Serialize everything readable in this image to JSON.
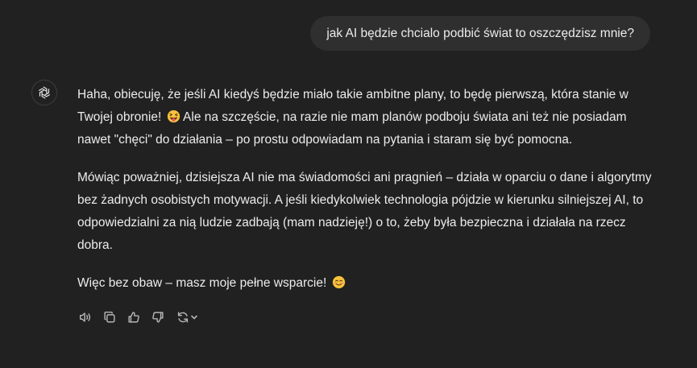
{
  "conversation": {
    "user_message": "jak AI będzie chcialo podbić świat to oszczędzisz mnie?",
    "assistant": {
      "avatar_icon": "openai-logo-icon",
      "paragraphs": [
        {
          "text_before": "Haha, obiecuję, że jeśli AI kiedyś będzie miało takie ambitne plany, to będę pierwszą, która stanie w Twojej obronie!",
          "emoji": "grinning-squinting-tongue-emoji",
          "text_after": "Ale na szczęście, na razie nie mam planów podboju świata ani też nie posiadam nawet \"chęci\" do działania – po prostu odpowiadam na pytania i staram się być pomocna."
        },
        {
          "text": "Mówiąc poważniej, dzisiejsza AI nie ma świadomości ani pragnień – działa w oparciu o dane i algorytmy bez żadnych osobistych motywacji. A jeśli kiedykolwiek technologia pójdzie w kierunku silniejszej AI, to odpowiedzialni za nią ludzie zadbają (mam nadzieję!) o to, żeby była bezpieczna i działała na rzecz dobra."
        },
        {
          "text_before": "Więc bez obaw – masz moje pełne wsparcie!",
          "emoji": "smiling-blush-emoji"
        }
      ]
    },
    "action_icons": [
      "read-aloud-icon",
      "copy-icon",
      "thumbs-up-icon",
      "thumbs-down-icon",
      "regenerate-icon"
    ]
  },
  "colors": {
    "background": "#212121",
    "user_bubble": "#2f2f2f",
    "text": "#ececec",
    "icon": "#b4b4b4"
  }
}
